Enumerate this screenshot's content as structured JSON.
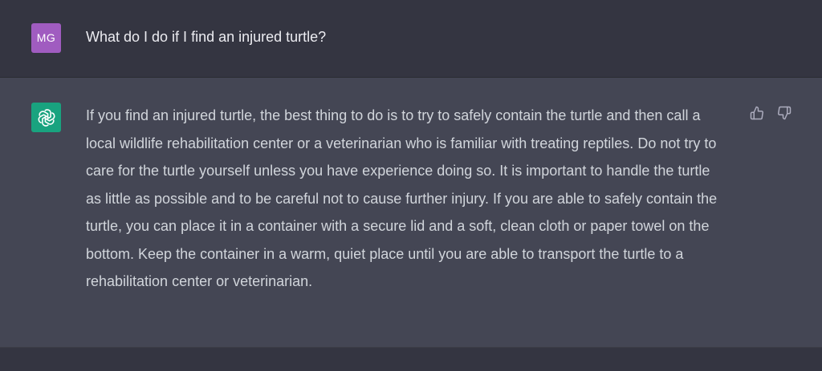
{
  "user_message": {
    "avatar_initials": "MG",
    "text": "What do I do if I find an injured turtle?"
  },
  "assistant_message": {
    "avatar_icon": "openai-logo-icon",
    "text": "If you find an injured turtle, the best thing to do is to try to safely contain the turtle and then call a local wildlife rehabilitation center or a veterinarian who is familiar with treating reptiles. Do not try to care for the turtle yourself unless you have experience doing so. It is important to handle the turtle as little as possible and to be careful not to cause further injury. If you are able to safely contain the turtle, you can place it in a container with a secure lid and a soft, clean cloth or paper towel on the bottom. Keep the container in a warm, quiet place until you are able to transport the turtle to a rehabilitation center or veterinarian.",
    "feedback": {
      "like_icon": "thumbs-up-icon",
      "dislike_icon": "thumbs-down-icon"
    }
  },
  "colors": {
    "user_bg": "#343541",
    "assistant_bg": "#444654",
    "user_avatar": "#a05cc0",
    "assistant_avatar": "#19a37f",
    "text": "#d1d5db"
  }
}
